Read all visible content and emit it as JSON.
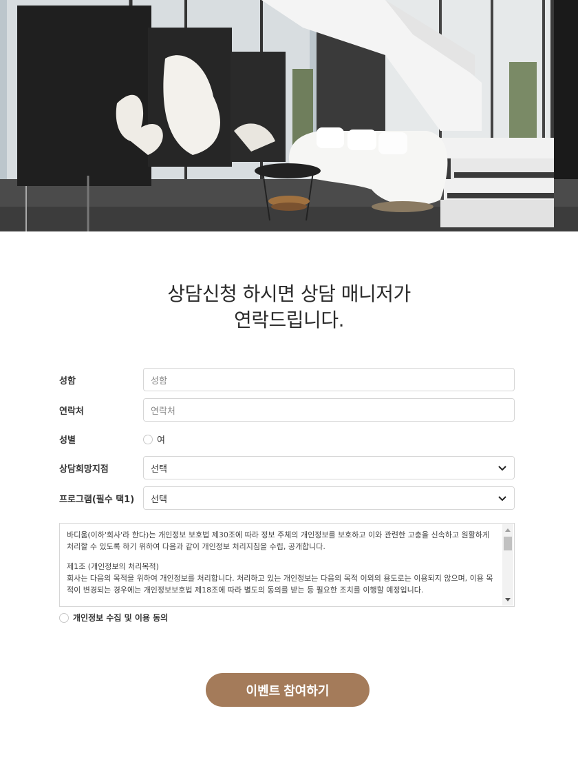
{
  "hero": {
    "image": "interior-showroom-photo"
  },
  "headline": {
    "line1": "상담신청 하시면 상담 매니저가",
    "line2": "연락드립니다."
  },
  "form": {
    "name": {
      "label": "성함",
      "placeholder": "성함"
    },
    "phone": {
      "label": "연락처",
      "placeholder": "연락처"
    },
    "gender": {
      "label": "성별",
      "option": "여"
    },
    "branch": {
      "label": "상담희망지점",
      "selected": "선택"
    },
    "program": {
      "label": "프로그램(필수 택1)",
      "selected": "선택"
    },
    "terms": {
      "intro": "바디움(이하'회사'라 한다)는 개인정보 보호법 제30조에 따라 정보 주체의 개인정보를 보호하고 이와 관련한 고충을 신속하고 원활하게 처리할 수 있도록 하기 위하여 다음과 같이 개인정보 처리지침을 수립, 공개합니다.",
      "article_title": "제1조 (개인정보의 처리목적)",
      "article_body": "회사는 다음의 목적을 위하여 개인정보를 처리합니다. 처리하고 있는 개인정보는 다음의 목적 이외의 용도로는 이용되지 않으며, 이용 목적이 변경되는 경우에는 개인정보보호법 제18조에 따라 별도의 동의를 받는 등 필요한 조치를 이행할 예정입니다."
    },
    "agree_label": "개인정보 수집 및 이용 동의",
    "submit_label": "이벤트 참여하기"
  },
  "colors": {
    "accent": "#a47b5a",
    "border": "#d6d6d6"
  }
}
